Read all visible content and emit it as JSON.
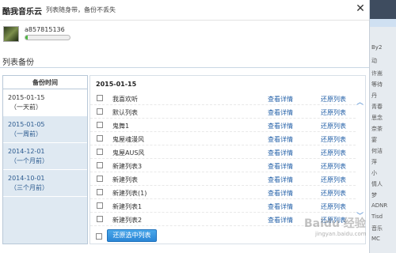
{
  "window": {
    "title": "酷我音乐云",
    "slogan": "列表随身带，备份不丢失",
    "close_glyph": "✕"
  },
  "user": {
    "name": "a857815136",
    "progress": 0.05
  },
  "tabs": [
    "列表备份"
  ],
  "sidebar": {
    "header": "备份时间",
    "items": [
      {
        "date": "2015-01-15",
        "ago": "（一天前）",
        "active": true
      },
      {
        "date": "2015-01-05",
        "ago": "（一周前）",
        "active": false
      },
      {
        "date": "2014-12-01",
        "ago": "（一个月前）",
        "active": false
      },
      {
        "date": "2014-10-01",
        "ago": "（三个月前）",
        "active": false
      }
    ]
  },
  "content": {
    "date": "2015-01-15",
    "rows": [
      {
        "name": "我喜欢听",
        "detail": "查看详情",
        "restore": "还原列表"
      },
      {
        "name": "默认列表",
        "detail": "查看详情",
        "restore": "还原列表"
      },
      {
        "name": "鬼舞1",
        "detail": "查看详情",
        "restore": "还原列表"
      },
      {
        "name": "鬼屋魂漫风",
        "detail": "查看详情",
        "restore": "还原列表"
      },
      {
        "name": "鬼屋AUS风",
        "detail": "查看详情",
        "restore": "还原列表"
      },
      {
        "name": "新建列表3",
        "detail": "查看详情",
        "restore": "还原列表"
      },
      {
        "name": "新建列表",
        "detail": "查看详情",
        "restore": "还原列表"
      },
      {
        "name": "新建列表(1)",
        "detail": "查看详情",
        "restore": "还原列表"
      },
      {
        "name": "新建列表1",
        "detail": "查看详情",
        "restore": "还原列表"
      },
      {
        "name": "新建列表2",
        "detail": "查看详情",
        "restore": "还原列表"
      }
    ]
  },
  "footer": {
    "restore_selected": "还原选中列表"
  },
  "scroll": {
    "up_glyph": "︿",
    "down_glyph": "﹀"
  },
  "right_strip": [
    "By2",
    "动",
    "许嵩",
    "等待",
    "丹",
    "青春",
    "思念",
    "奈茶",
    "宴",
    "何洁",
    "萍",
    "小",
    "情人",
    "梦",
    "ADNR",
    "Tisd",
    "音乐",
    "MC"
  ],
  "watermark": {
    "text": "Baidu 经验",
    "sub": "jingyan.baidu.com"
  }
}
